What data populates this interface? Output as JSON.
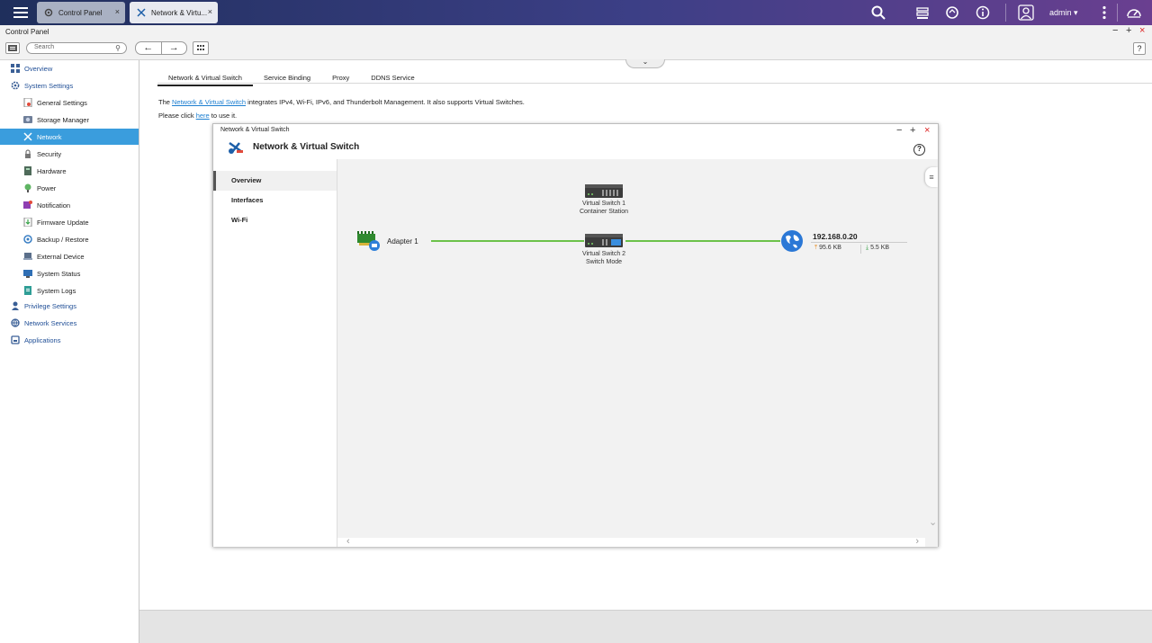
{
  "taskbar": {
    "tabs": [
      {
        "label": "Control Panel",
        "close": "×"
      },
      {
        "label": "Network & Virtu...",
        "close": "×"
      }
    ],
    "user": "admin ▾"
  },
  "window": {
    "title": "Control Panel",
    "controls": {
      "minimize": "−",
      "maximize": "+",
      "close": "×"
    }
  },
  "toolbar": {
    "search_placeholder": "Search",
    "back": "←",
    "forward": "→",
    "help": "?"
  },
  "sidebar": {
    "overview": "Overview",
    "system_settings": "System Settings",
    "items": [
      "General Settings",
      "Storage Manager",
      "Network",
      "Security",
      "Hardware",
      "Power",
      "Notification",
      "Firmware Update",
      "Backup / Restore",
      "External Device",
      "System Status",
      "System Logs"
    ],
    "privilege_settings": "Privilege Settings",
    "network_services": "Network Services",
    "applications": "Applications"
  },
  "main": {
    "tabs": [
      "Network & Virtual Switch",
      "Service Binding",
      "Proxy",
      "DDNS Service"
    ],
    "desc1": {
      "prefix": "The ",
      "link": "Network & Virtual Switch",
      "suffix": " integrates IPv4, Wi-Fi, IPv6, and Thunderbolt Management. It also supports Virtual Switches."
    },
    "desc2": {
      "prefix": "Please click ",
      "link": "here",
      "suffix": " to use it."
    },
    "collapse": "⌄"
  },
  "inner_window": {
    "title": "Network & Virtual Switch",
    "heading": "Network & Virtual Switch",
    "controls": {
      "minimize": "−",
      "maximize": "+",
      "close": "×"
    },
    "help": "?",
    "nav": [
      "Overview",
      "Interfaces",
      "Wi-Fi"
    ],
    "diagram": {
      "switch1": {
        "line1": "Virtual Switch 1",
        "line2": "Container Station"
      },
      "switch2": {
        "line1": "Virtual Switch 2",
        "line2": "Switch Mode"
      },
      "adapter": "Adapter 1",
      "ip": "192.168.0.20",
      "upload": "95.6 KB",
      "download": "5.5 KB",
      "link_color": "#6cc24a"
    },
    "scroll": {
      "left": "‹",
      "right": "›",
      "down": "⌄"
    },
    "hamburger": "≡"
  }
}
